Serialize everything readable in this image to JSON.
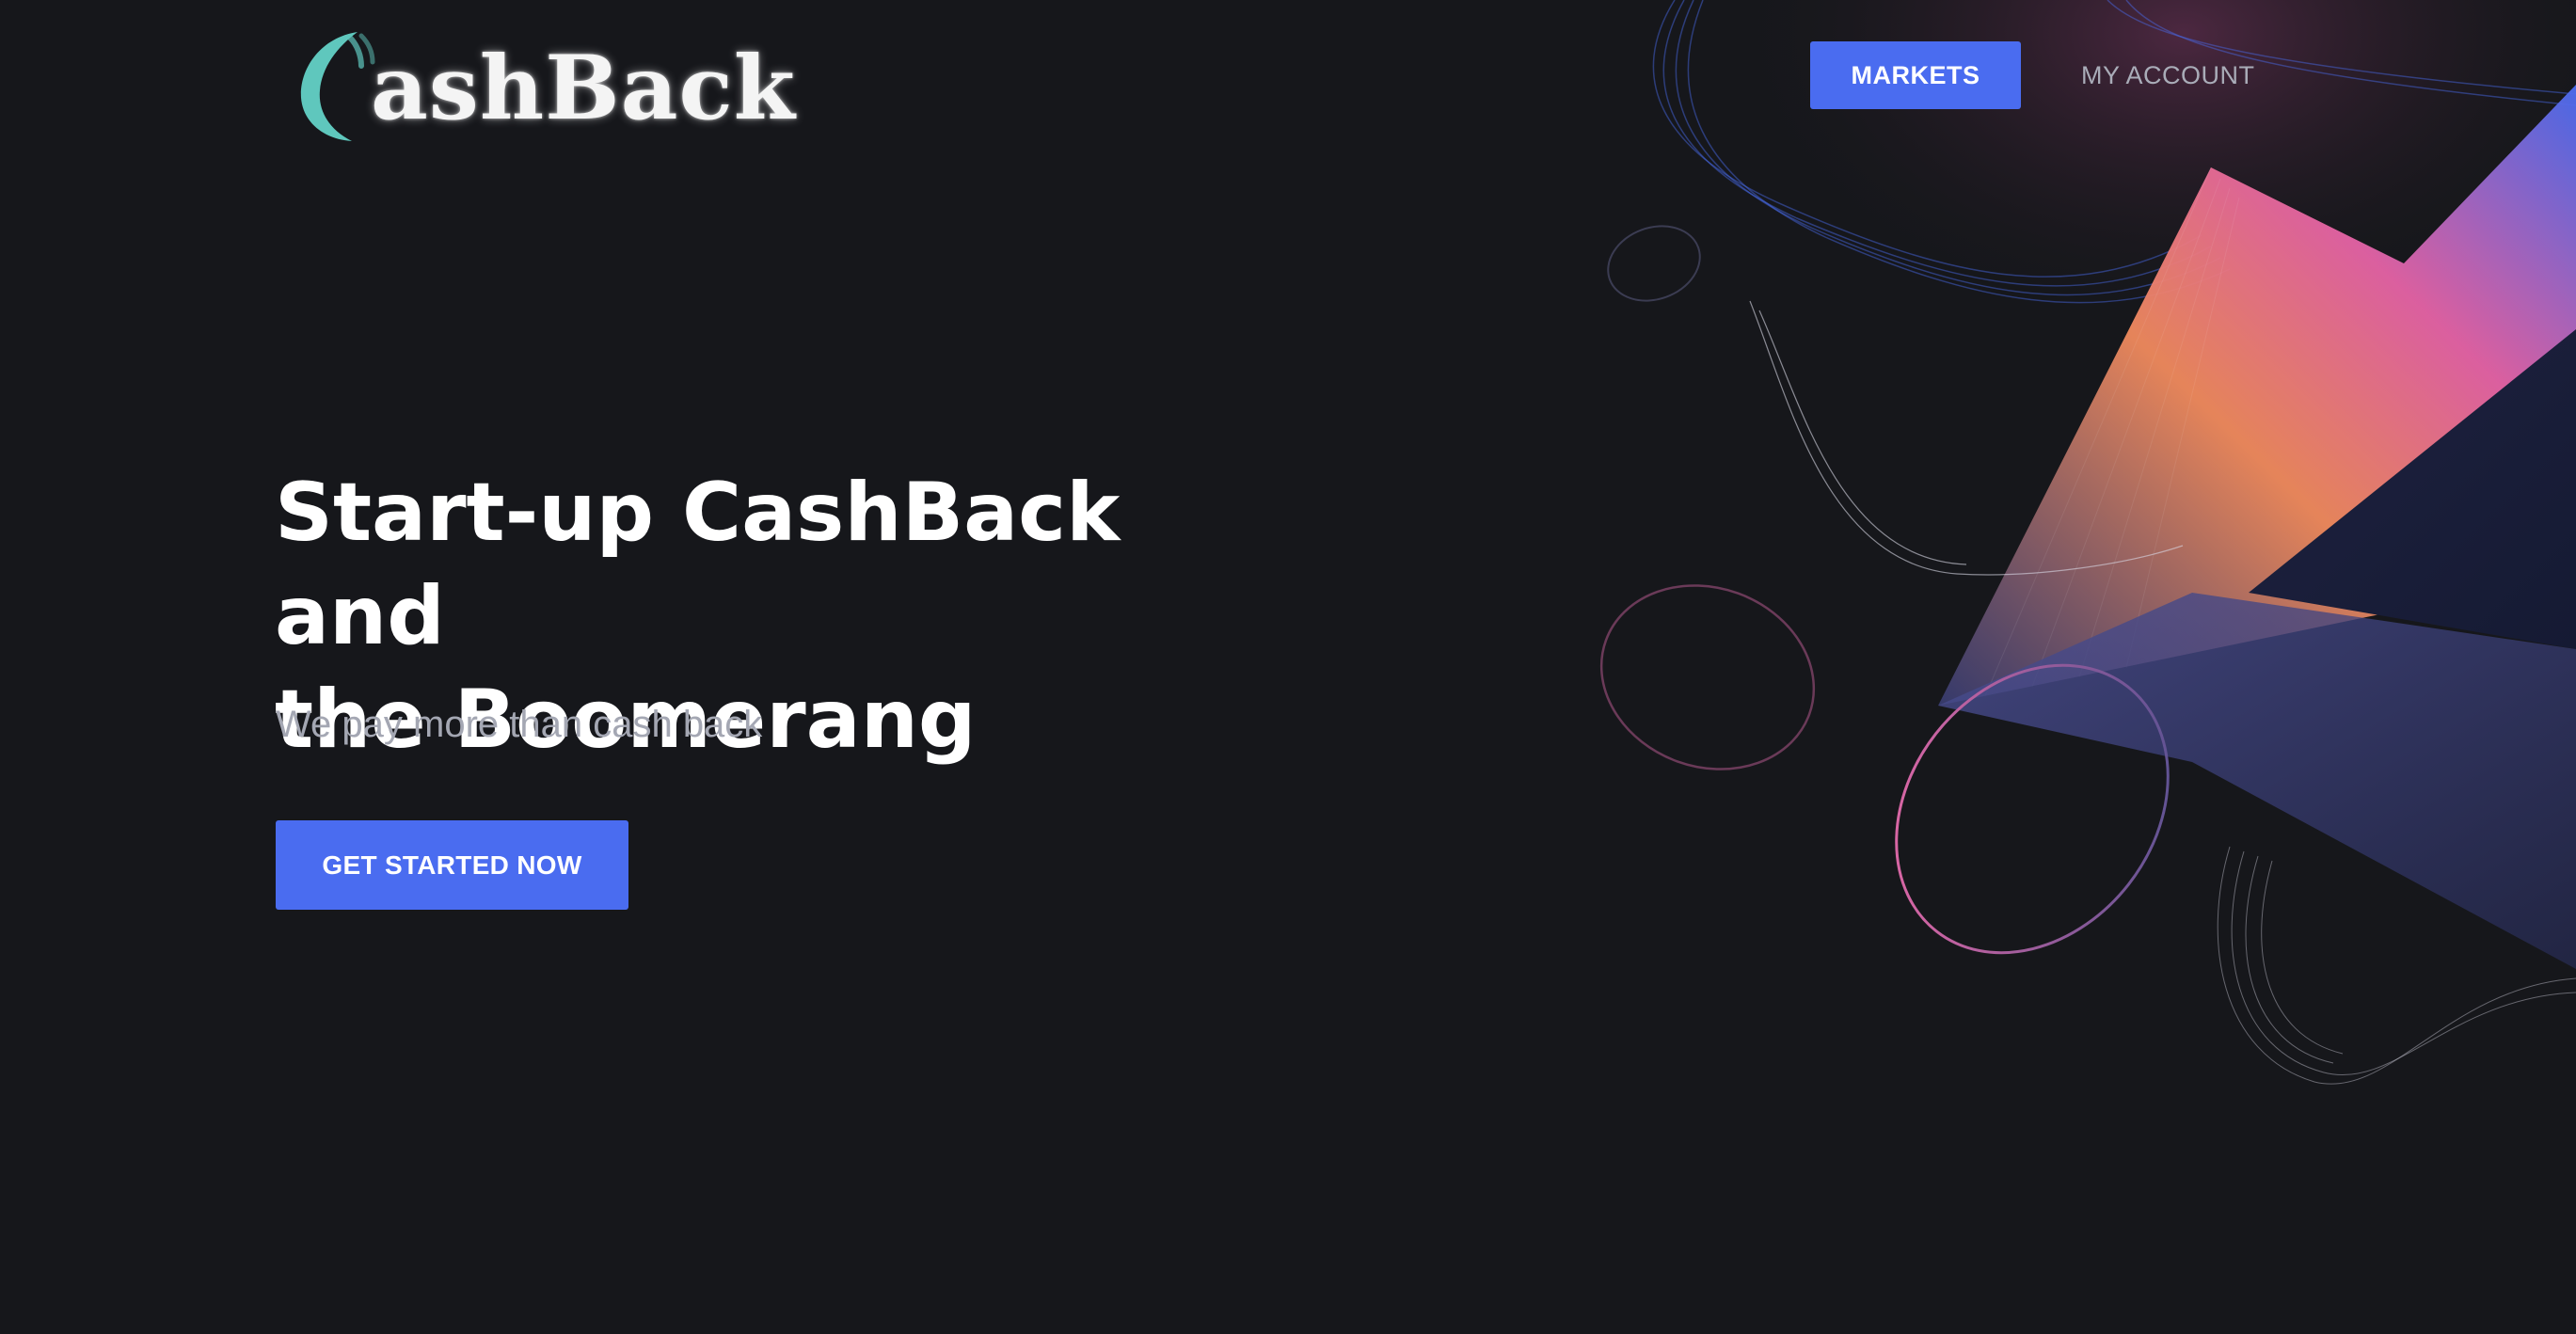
{
  "brand": {
    "logo_text": "ashBack",
    "logo_mark_icon": "boomerang-c-icon",
    "accent_color": "#5fc7bd"
  },
  "nav": {
    "markets_label": "MARKETS",
    "account_label": "MY ACCOUNT"
  },
  "hero": {
    "title_line1": "Start-up CashBack and",
    "title_line2": "the Boomerang",
    "subtitle": "We pay more than cash back",
    "cta_label": "GET STARTED NOW"
  },
  "colors": {
    "background": "#16171b",
    "primary": "#4a6cf0",
    "text": "#ffffff",
    "muted": "#a4a7b3",
    "art_pink": "#e0609f",
    "art_orange": "#f08a5d",
    "art_blue": "#4a6cf0"
  }
}
